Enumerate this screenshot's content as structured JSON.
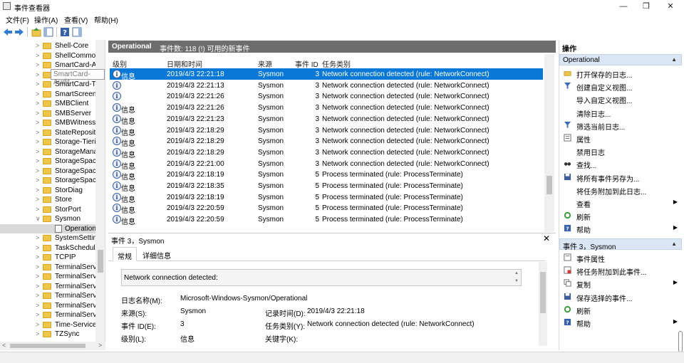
{
  "window": {
    "title": "事件查看器",
    "minimize_glyph": "—",
    "maximize_glyph": "❐",
    "close_glyph": "✕"
  },
  "menu": [
    "文件(F)",
    "操作(A)",
    "查看(V)",
    "帮助(H)"
  ],
  "toolbar": {
    "icons": [
      "back-arrow-icon",
      "forward-arrow-icon",
      "up-folder-icon",
      "show-hide-tree-icon",
      "help-icon",
      "show-hide-action-pane-icon"
    ]
  },
  "tree": {
    "items": [
      {
        "label": "Shell-Core",
        "type": "folder",
        "arrow": ">"
      },
      {
        "label": "ShellCommon",
        "type": "folder",
        "arrow": ">"
      },
      {
        "label": "SmartCard-Au",
        "type": "folder",
        "arrow": ">"
      },
      {
        "label": "SmartCard-Audit",
        "type": "folder",
        "arrow": ">"
      },
      {
        "label": "SmartCard-TP",
        "type": "folder",
        "arrow": ">"
      },
      {
        "label": "SmartScreen",
        "type": "folder",
        "arrow": ">"
      },
      {
        "label": "SMBClient",
        "type": "folder",
        "arrow": ">"
      },
      {
        "label": "SMBServer",
        "type": "folder",
        "arrow": ">"
      },
      {
        "label": "SMBWitnessC",
        "type": "folder",
        "arrow": ">"
      },
      {
        "label": "StateReposito",
        "type": "folder",
        "arrow": ">"
      },
      {
        "label": "Storage-Tierin",
        "type": "folder",
        "arrow": ">"
      },
      {
        "label": "StorageManag",
        "type": "folder",
        "arrow": ">"
      },
      {
        "label": "StorageSpace",
        "type": "folder",
        "arrow": ">"
      },
      {
        "label": "StorageSpace",
        "type": "folder",
        "arrow": ">"
      },
      {
        "label": "StorageSpace",
        "type": "folder",
        "arrow": ">"
      },
      {
        "label": "StorDiag",
        "type": "folder",
        "arrow": ">"
      },
      {
        "label": "Store",
        "type": "folder",
        "arrow": ">"
      },
      {
        "label": "StorPort",
        "type": "folder",
        "arrow": ">"
      },
      {
        "label": "Sysmon",
        "type": "folder",
        "arrow": "∨"
      },
      {
        "label": "Operationa",
        "type": "log",
        "arrow": ""
      },
      {
        "label": "SystemSetting",
        "type": "folder",
        "arrow": ">"
      },
      {
        "label": "TaskSchedule",
        "type": "folder",
        "arrow": ">"
      },
      {
        "label": "TCPIP",
        "type": "folder",
        "arrow": ">"
      },
      {
        "label": "TerminalServi",
        "type": "folder",
        "arrow": ">"
      },
      {
        "label": "TerminalServi",
        "type": "folder",
        "arrow": ">"
      },
      {
        "label": "TerminalServi",
        "type": "folder",
        "arrow": ">"
      },
      {
        "label": "TerminalServi",
        "type": "folder",
        "arrow": ">"
      },
      {
        "label": "TerminalServi",
        "type": "folder",
        "arrow": ">"
      },
      {
        "label": "TerminalServi",
        "type": "folder",
        "arrow": ">"
      },
      {
        "label": "Time-Service",
        "type": "folder",
        "arrow": ">"
      },
      {
        "label": "TZSync",
        "type": "folder",
        "arrow": ">"
      }
    ],
    "tooltip": "SmartCard-Audit",
    "scroll_left": "<",
    "scroll_right": ">"
  },
  "events": {
    "log_name": "Operational",
    "count_text": "事件数: 118 (!) 可用的新事件",
    "columns": [
      "级别",
      "日期和时间",
      "来源",
      "事件 ID",
      "任务类别"
    ],
    "rows": [
      {
        "level": "信息",
        "datetime": "2019/4/3 22:21:18",
        "source": "Sysmon",
        "id": "3",
        "task": "Network connection detected (rule: NetworkConnect)",
        "selected": true
      },
      {
        "level": "",
        "datetime": "2019/4/3 22:21:13",
        "source": "Sysmon",
        "id": "3",
        "task": "Network connection detected (rule: NetworkConnect)"
      },
      {
        "level": "",
        "datetime": "2019/4/3 22:21:26",
        "source": "Sysmon",
        "id": "3",
        "task": "Network connection detected (rule: NetworkConnect)"
      },
      {
        "level": "信息",
        "datetime": "2019/4/3 22:21:26",
        "source": "Sysmon",
        "id": "3",
        "task": "Network connection detected (rule: NetworkConnect)"
      },
      {
        "level": "信息",
        "datetime": "2019/4/3 22:21:23",
        "source": "Sysmon",
        "id": "3",
        "task": "Network connection detected (rule: NetworkConnect)"
      },
      {
        "level": "信息",
        "datetime": "2019/4/3 22:18:29",
        "source": "Sysmon",
        "id": "3",
        "task": "Network connection detected (rule: NetworkConnect)"
      },
      {
        "level": "信息",
        "datetime": "2019/4/3 22:18:29",
        "source": "Sysmon",
        "id": "3",
        "task": "Network connection detected (rule: NetworkConnect)"
      },
      {
        "level": "信息",
        "datetime": "2019/4/3 22:18:29",
        "source": "Sysmon",
        "id": "3",
        "task": "Network connection detected (rule: NetworkConnect)"
      },
      {
        "level": "信息",
        "datetime": "2019/4/3 22:21:00",
        "source": "Sysmon",
        "id": "3",
        "task": "Network connection detected (rule: NetworkConnect)"
      },
      {
        "level": "信息",
        "datetime": "2019/4/3 22:18:19",
        "source": "Sysmon",
        "id": "5",
        "task": "Process terminated (rule: ProcessTerminate)"
      },
      {
        "level": "信息",
        "datetime": "2019/4/3 22:18:35",
        "source": "Sysmon",
        "id": "5",
        "task": "Process terminated (rule: ProcessTerminate)"
      },
      {
        "level": "信息",
        "datetime": "2019/4/3 22:18:19",
        "source": "Sysmon",
        "id": "5",
        "task": "Process terminated (rule: ProcessTerminate)"
      },
      {
        "level": "信息",
        "datetime": "2019/4/3 22:20:59",
        "source": "Sysmon",
        "id": "5",
        "task": "Process terminated (rule: ProcessTerminate)"
      },
      {
        "level": "信息",
        "datetime": "2019/4/3 22:20:59",
        "source": "Sysmon",
        "id": "5",
        "task": "Process terminated (rule: ProcessTerminate)"
      }
    ]
  },
  "detail": {
    "header": "事件 3，Sysmon",
    "close_glyph": "✕",
    "tabs": [
      "常规",
      "详细信息"
    ],
    "description": "Network connection detected:",
    "fields": {
      "log_name_label": "日志名称(M):",
      "log_name_value": "Microsoft-Windows-Sysmon/Operational",
      "source_label": "来源(S):",
      "source_value": "Sysmon",
      "logged_label": "记录时间(D):",
      "logged_value": "2019/4/3 22:21:18",
      "event_id_label": "事件 ID(E):",
      "event_id_value": "3",
      "task_label": "任务类别(Y):",
      "task_value": "Network connection detected (rule: NetworkConnect)",
      "level_label": "级别(L):",
      "level_value": "信息",
      "keywords_label": "关键字(K):"
    }
  },
  "actions": {
    "title": "操作",
    "section1": "Operational",
    "items1": [
      {
        "label": "打开保存的日志...",
        "icon": "open-folder-icon"
      },
      {
        "label": "创建自定义视图...",
        "icon": "filter-icon"
      },
      {
        "label": "导入自定义视图...",
        "icon": ""
      },
      {
        "label": "清除日志...",
        "icon": ""
      },
      {
        "label": "筛选当前日志...",
        "icon": "filter-icon"
      },
      {
        "label": "属性",
        "icon": "properties-icon"
      },
      {
        "label": "禁用日志",
        "icon": ""
      },
      {
        "label": "查找...",
        "icon": "binoculars-icon"
      },
      {
        "label": "将所有事件另存为...",
        "icon": "save-icon"
      },
      {
        "label": "将任务附加到此日志...",
        "icon": ""
      },
      {
        "label": "查看",
        "icon": "",
        "submenu": true
      },
      {
        "label": "刷新",
        "icon": "refresh-icon"
      },
      {
        "label": "帮助",
        "icon": "help-icon",
        "submenu": true
      }
    ],
    "section2": "事件 3，Sysmon",
    "items2": [
      {
        "label": "事件属性",
        "icon": "event-properties-icon"
      },
      {
        "label": "将任务附加到此事件...",
        "icon": "attach-task-icon"
      },
      {
        "label": "复制",
        "icon": "copy-icon",
        "submenu": true
      },
      {
        "label": "保存选择的事件...",
        "icon": "save-icon"
      },
      {
        "label": "刷新",
        "icon": "refresh-icon"
      },
      {
        "label": "帮助",
        "icon": "help-icon",
        "submenu": true
      }
    ]
  }
}
